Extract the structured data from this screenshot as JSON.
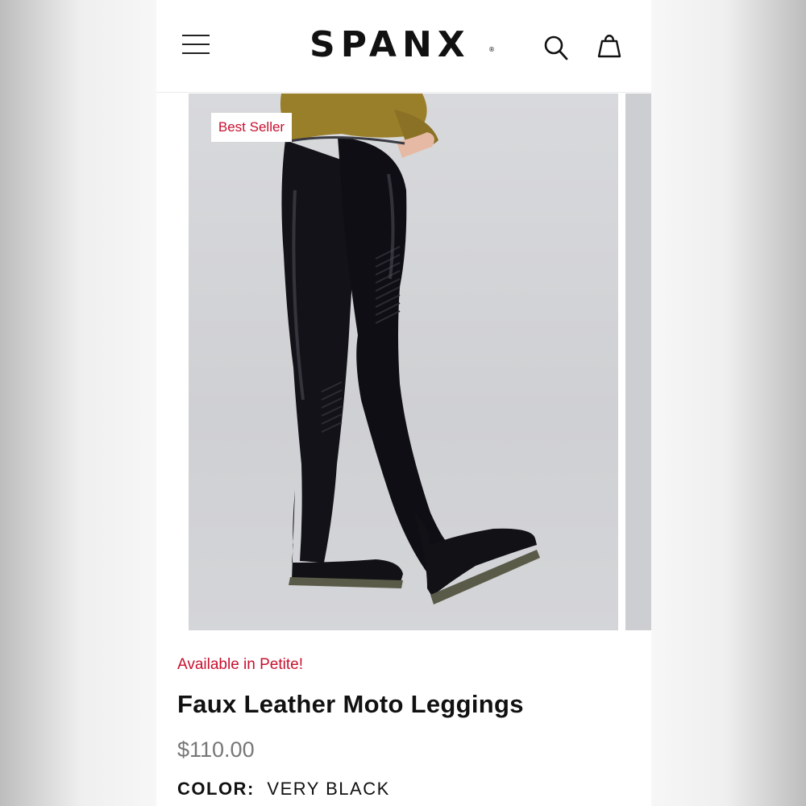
{
  "header": {
    "logo_text": "SPANX",
    "logo_mark": "®",
    "menu_icon": "hamburger-menu-icon",
    "search_icon": "search-icon",
    "bag_icon": "shopping-bag-icon"
  },
  "gallery": {
    "badge": "Best Seller",
    "image_subject": "model wearing black faux leather moto leggings with mustard sweater and black lug-sole boots"
  },
  "product": {
    "promo": "Available in Petite!",
    "title": "Faux Leather Moto Leggings",
    "price": "$110.00",
    "color_label": "COLOR:",
    "color_value": "VERY BLACK"
  },
  "colors": {
    "accent_red": "#c8102e",
    "price_gray": "#777777",
    "text_dark": "#111111"
  }
}
